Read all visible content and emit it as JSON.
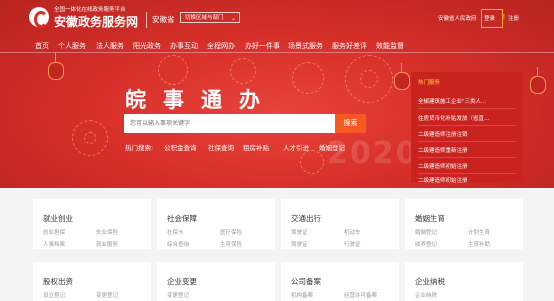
{
  "site": {
    "tagline": "全国一体化在线政务服务平台",
    "name": "安徽政务服务网",
    "province": "安徽省",
    "region_select": "切换区域与部门"
  },
  "top_links": {
    "user": "安徽省人民政府",
    "login": "登录",
    "divider": "|",
    "register": "注册"
  },
  "nav": [
    "首页",
    "个人服务",
    "法人服务",
    "阳光政务",
    "办事互动",
    "全程网办",
    "办好一件事",
    "场景式服务",
    "服务好差评",
    "效能监督"
  ],
  "hero": {
    "headline": "皖事通办",
    "year": "2020",
    "search_placeholder": "您可以输入事项关键字",
    "search_button": "搜索",
    "hot_items": [
      "热门搜索:",
      "公积金查询",
      "社保查询",
      "租房补贴",
      "人才引进",
      "婚姻登记"
    ]
  },
  "hot_panel": {
    "title": "热门服务",
    "items": [
      "全椒建筑施工企业\"三类人...",
      "住房货币化补贴发放（省直...",
      "二级建造师注册注销",
      "二级建造师重新注册",
      "二级建造师初始注册",
      "二级建造师初始注册"
    ]
  },
  "cards": [
    {
      "title": "就业创业",
      "links": [
        "创业担保",
        "失业保险",
        "人事档案",
        "就业服务"
      ]
    },
    {
      "title": "社会保障",
      "links": [
        "社保卡",
        "医疗保险",
        "综合查询",
        "生育保险"
      ]
    },
    {
      "title": "交通出行",
      "links": [
        "驾驶证",
        "机动车",
        "驾驶证",
        "行驶证"
      ]
    },
    {
      "title": "婚姻生育",
      "links": [
        "婚姻登记",
        "计划生育",
        "收养登记",
        "生育补助"
      ]
    },
    {
      "title": "股权出资",
      "links": [
        "设立登记",
        "变更登记"
      ]
    },
    {
      "title": "企业变更",
      "links": [
        "变更登记"
      ]
    },
    {
      "title": "公司备案",
      "links": [
        "机构备案",
        "经营许可备案"
      ]
    },
    {
      "title": "企业纳税",
      "links": [
        "企业纳税"
      ]
    }
  ],
  "colors": {
    "brand_red": "#d8302a",
    "search_orange": "#f65a22",
    "panel_red": "#c9231f",
    "highlight": "#f6b020"
  }
}
